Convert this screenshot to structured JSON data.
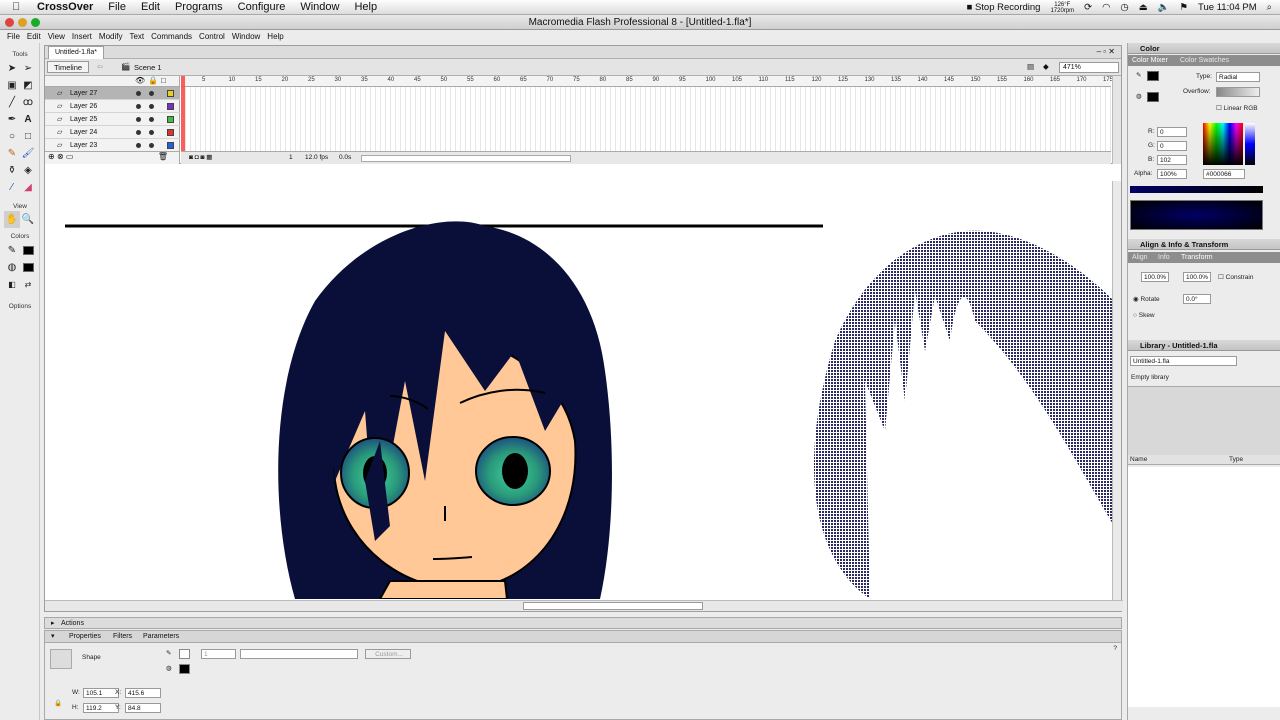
{
  "macmenu": {
    "app": "CrossOver",
    "items": [
      "File",
      "Edit",
      "Programs",
      "Configure",
      "Window",
      "Help"
    ],
    "status": "Stop Recording",
    "temp": "126°F",
    "rpm": "1720rpm",
    "clock": "Tue 11:04 PM"
  },
  "window": {
    "title": "Macromedia Flash Professional 8 - [Untitled-1.fla*]"
  },
  "appmenu": [
    "File",
    "Edit",
    "View",
    "Insert",
    "Modify",
    "Text",
    "Commands",
    "Control",
    "Window",
    "Help"
  ],
  "tools": {
    "label_tools": "Tools",
    "label_view": "View",
    "label_colors": "Colors",
    "label_options": "Options"
  },
  "document": {
    "tab": "Untitled-1.fla*",
    "timeline_btn": "Timeline",
    "scene": "Scene 1",
    "zoom": "471%"
  },
  "layers": [
    "Layer 27",
    "Layer 26",
    "Layer 25",
    "Layer 24",
    "Layer 23"
  ],
  "layer_colors": [
    "#e8d020",
    "#7a2fc0",
    "#40c040",
    "#e03030",
    "#2060e0"
  ],
  "ruler": [
    "5",
    "10",
    "15",
    "20",
    "25",
    "30",
    "35",
    "40",
    "45",
    "50",
    "55",
    "60",
    "65",
    "70",
    "75",
    "80",
    "85",
    "90",
    "95",
    "100",
    "105",
    "110",
    "115",
    "120",
    "125",
    "130",
    "135",
    "140",
    "145",
    "150",
    "155",
    "160",
    "165",
    "170",
    "175"
  ],
  "timeline_status": {
    "frame": "1",
    "fps": "12.0 fps",
    "time": "0.0s"
  },
  "panels": {
    "actions": "Actions",
    "props_tabs": [
      "Properties",
      "Filters",
      "Parameters"
    ],
    "shape_label": "Shape",
    "stroke_size": "1",
    "custom_btn": "Custom...",
    "w_label": "W:",
    "w": "105.1",
    "h_label": "H:",
    "h": "119.2",
    "x_label": "X:",
    "x": "415.6",
    "y_label": "Y:",
    "y": "84.8"
  },
  "color": {
    "head": "Color",
    "tabs": [
      "Color Mixer",
      "Color Swatches"
    ],
    "type_label": "Type:",
    "type": "Radial",
    "overflow_label": "Overflow:",
    "linear_rgb": "Linear RGB",
    "r_label": "R:",
    "r": "0",
    "g_label": "G:",
    "g": "0",
    "b_label": "B:",
    "b": "102",
    "alpha_label": "Alpha:",
    "alpha": "100%",
    "hex": "#000066"
  },
  "transform": {
    "head": "Align & Info & Transform",
    "tabs": [
      "Align",
      "Info",
      "Transform"
    ],
    "w": "100.0%",
    "h": "100.0%",
    "constrain": "Constrain",
    "rotate": "Rotate",
    "rotate_val": "0.0°",
    "skew": "Skew"
  },
  "library": {
    "head": "Library - Untitled-1.fla",
    "select": "Untitled-1.fla",
    "empty": "Empty library",
    "col_name": "Name",
    "col_type": "Type"
  }
}
